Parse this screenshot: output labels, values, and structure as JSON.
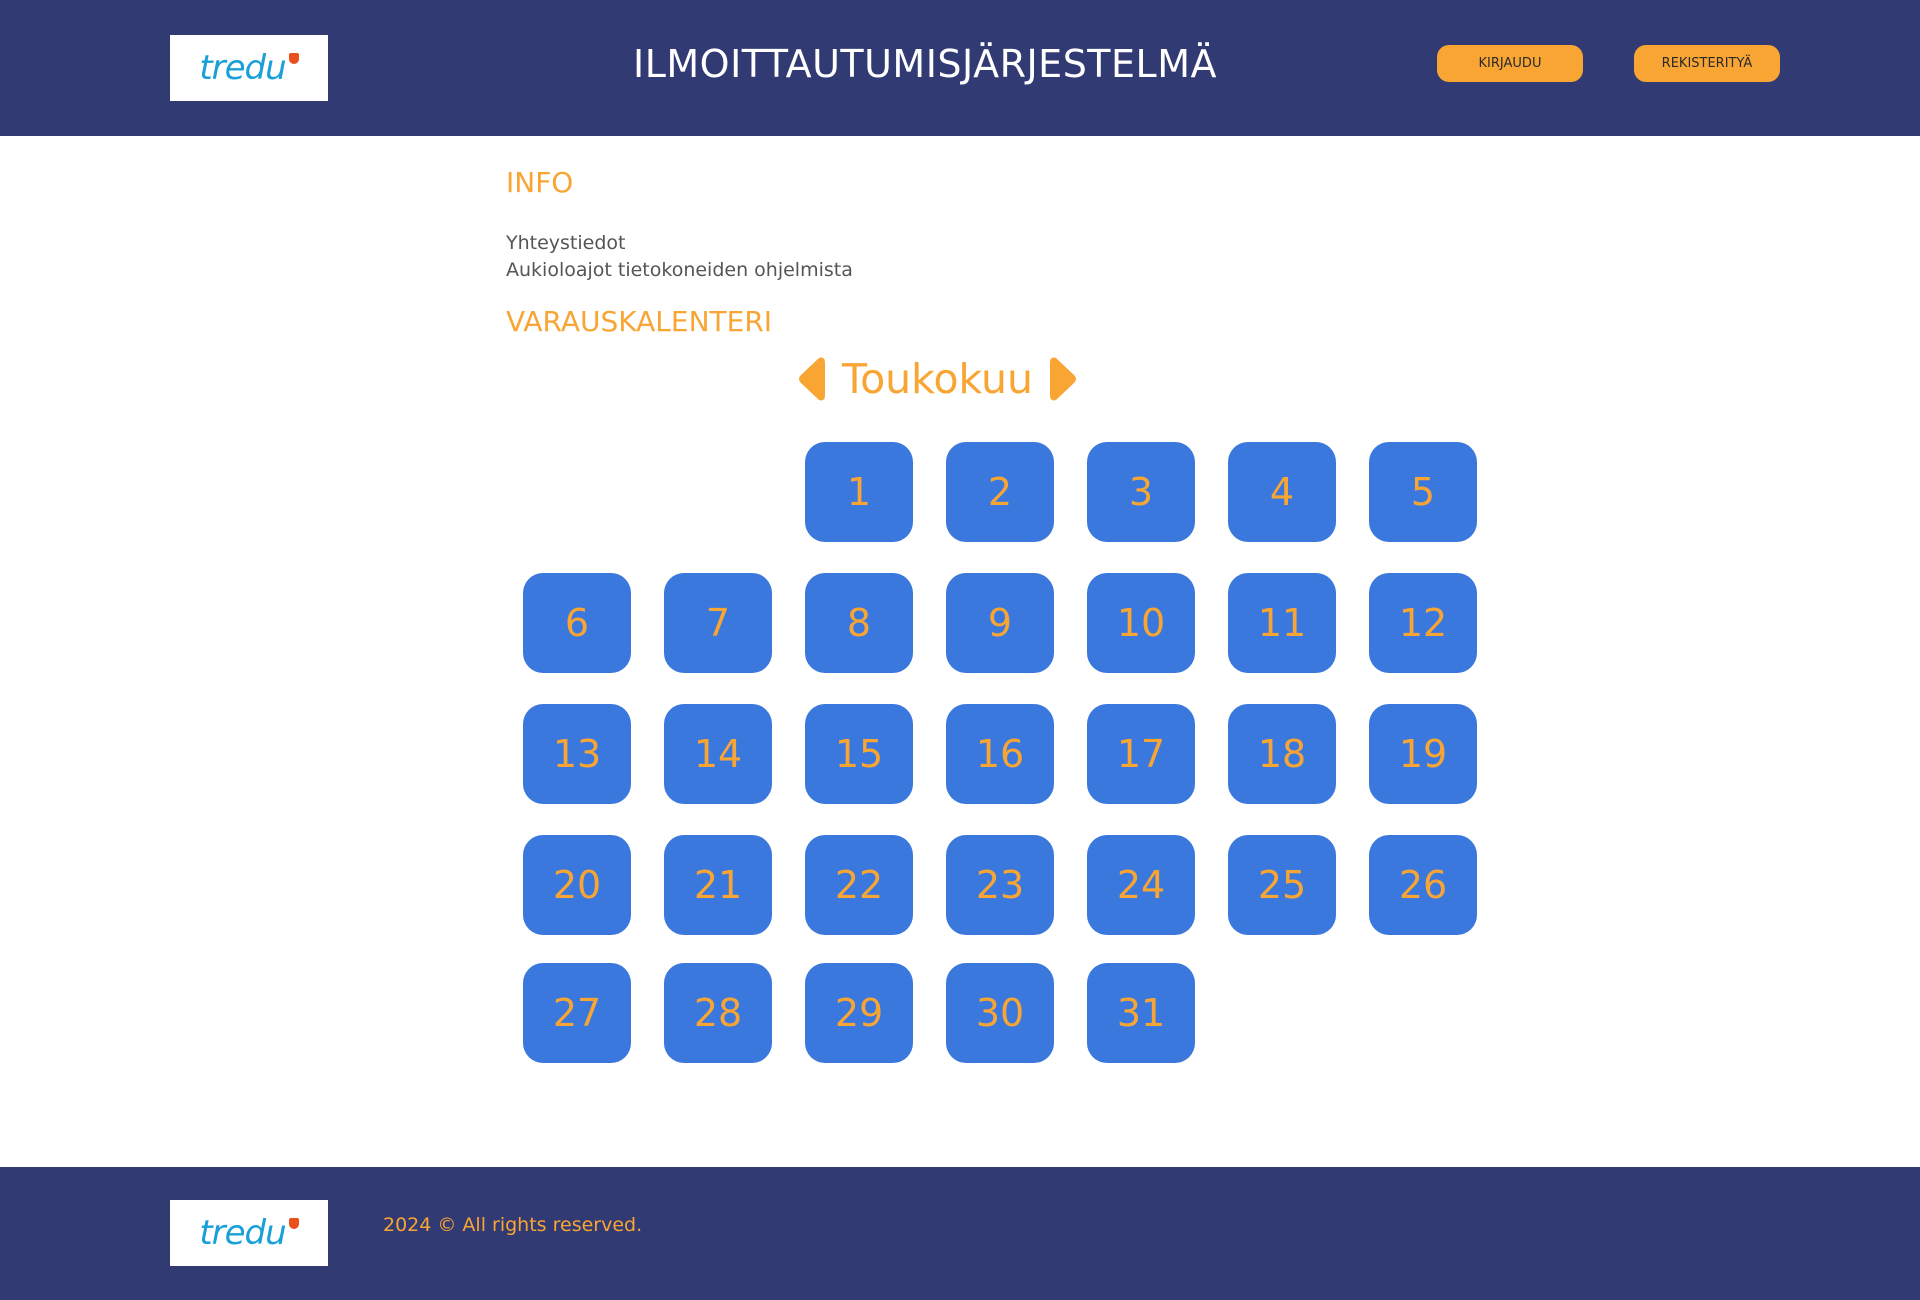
{
  "header": {
    "logo_text": "tredu",
    "title": "ILMOITTAUTUMISJÄRJESTELMÄ",
    "login_label": "KIRJAUDU",
    "register_label": "REKISTERITYÄ"
  },
  "info": {
    "heading": "INFO",
    "links": [
      "Yhteystiedot",
      "Aukioloajot tietokoneiden ohjelmista"
    ]
  },
  "calendar": {
    "heading": "VARAUSKALENTERI",
    "month": "Toukokuu",
    "days": [
      "1",
      "2",
      "3",
      "4",
      "5",
      "6",
      "7",
      "8",
      "9",
      "10",
      "11",
      "12",
      "13",
      "14",
      "15",
      "16",
      "17",
      "18",
      "19",
      "20",
      "21",
      "22",
      "23",
      "24",
      "25",
      "26",
      "27",
      "28",
      "29",
      "30",
      "31"
    ]
  },
  "footer": {
    "logo_text": "tredu",
    "copyright": "2024 © All rights reserved."
  },
  "colors": {
    "header_bg": "#323a73",
    "accent": "#f9a533",
    "day_bg": "#3b78de"
  }
}
